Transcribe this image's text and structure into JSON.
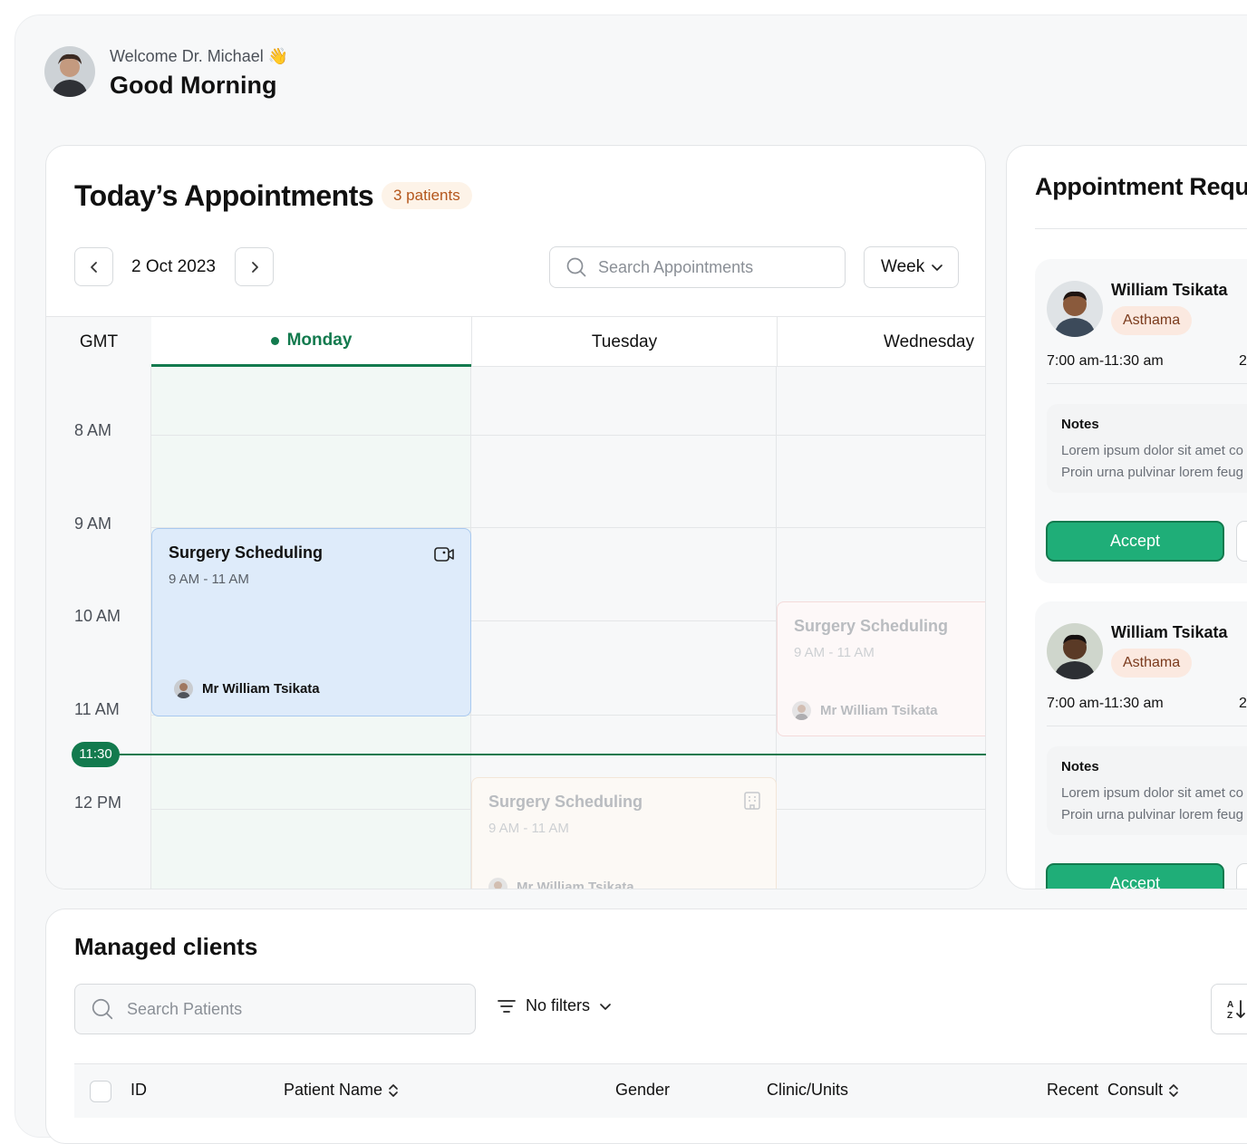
{
  "header": {
    "welcome": "Welcome Dr. Michael",
    "wave": "👋",
    "greeting": "Good Morning"
  },
  "appointments": {
    "title": "Today’s Appointments",
    "badge": "3 patients",
    "date": "2 Oct 2023",
    "search_placeholder": "Search Appointments",
    "view": "Week",
    "timezone": "GMT",
    "days": [
      "Monday",
      "Tuesday",
      "Wednesday"
    ],
    "times": [
      "8 AM",
      "9 AM",
      "10 AM",
      "11 AM",
      "12 PM"
    ],
    "now": "11:30",
    "events": [
      {
        "title": "Surgery Scheduling",
        "time": "9 AM - 11 AM",
        "person": "Mr William Tsikata",
        "icon": "video-icon"
      },
      {
        "title": "Surgery Scheduling",
        "time": "9 AM - 11 AM",
        "person": "Mr William Tsikata"
      },
      {
        "title": "Surgery Scheduling",
        "time": "9 AM - 11 AM",
        "person": "Mr William Tsikata",
        "icon": "building-icon"
      }
    ]
  },
  "requests": {
    "title": "Appointment Requests",
    "items": [
      {
        "name": "William Tsikata",
        "tag": "Asthama",
        "time": "7:00 am-11:30 am",
        "date_partial": "2",
        "notes_label": "Notes",
        "notes_line1": "Lorem ipsum dolor sit amet co",
        "notes_line2": "Proin urna pulvinar lorem feug",
        "accept": "Accept"
      },
      {
        "name": "William Tsikata",
        "tag": "Asthama",
        "time": "7:00 am-11:30 am",
        "date_partial": "2",
        "notes_label": "Notes",
        "notes_line1": "Lorem ipsum dolor sit amet co",
        "notes_line2": "Proin urna pulvinar lorem feug",
        "accept": "Accept"
      }
    ]
  },
  "clients": {
    "title": "Managed clients",
    "search_placeholder": "Search Patients",
    "filters": "No filters",
    "columns": [
      "ID",
      "Patient Name",
      "Gender",
      "Clinic/Units",
      "Recent  Consult"
    ]
  },
  "colors": {
    "accent": "#137a4e",
    "accept": "#1fae78",
    "event_blue": "#deebfa",
    "badge_bg": "#fdf3e8"
  }
}
